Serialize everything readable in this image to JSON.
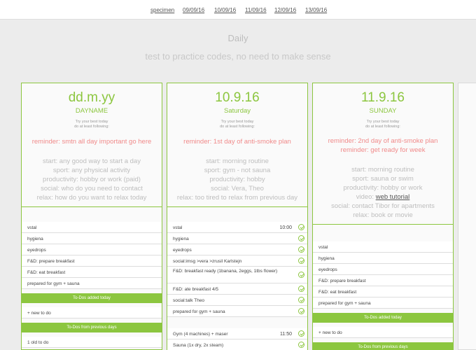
{
  "nav": [
    "specimen",
    "09/09/16",
    "10/09/16",
    "11/09/16",
    "12/09/16",
    "13/09/16"
  ],
  "title": "Daily",
  "subtitle": "test to practice codes, no need to make sense",
  "hint": [
    "Try your best today",
    "do at least following:"
  ],
  "cards": [
    {
      "date": "dd.m.yy",
      "dayname": "DAYNAME",
      "reminders": [
        "reminder: smtn all day important go here"
      ],
      "plan": [
        "start: any good way to start a day",
        "sport: any physical activity",
        "productivity: hobby or work (paid)",
        "social: who do you need to contact",
        "relax: how do you want to relax today"
      ],
      "tasks": [
        "vstal",
        "hygiena",
        "eyedrops",
        "F&D: prepare breakfast",
        "F&D: eat breakfast",
        "prepared for gym + sauna"
      ],
      "added_label": "To-Dos added today",
      "new_todo": "+ new to do",
      "prev_label": "To-Dos from previous days",
      "prev_tasks": [
        "1 old to do"
      ]
    },
    {
      "date": "10.9.16",
      "dayname": "Saturday",
      "reminders": [
        "reminder: 1st day of anti-smoke plan"
      ],
      "plan": [
        "start: morning routine",
        "sport: gym - not sauna",
        "productivity: hobby",
        "social: Vera, Theo",
        "relax: too tired to relax from previous day"
      ],
      "tasks": [
        {
          "text": "vstal",
          "time": "10:00"
        },
        {
          "text": "hygiena"
        },
        {
          "text": "eyedrops"
        },
        {
          "text": "social:imsg >vera >zrusil Karlstejn"
        },
        {
          "text": "F&D: breakfast ready (1banana, 2eggs, 1tbs flower)",
          "tall": true
        },
        {
          "text": "F&D: ate breakfast 4/5"
        },
        {
          "text": "social:talk Theo"
        },
        {
          "text": "prepared for gym + sauna"
        }
      ],
      "tasks2": [
        {
          "text": "Gym (4 machines) + maser",
          "time": "11:50"
        },
        {
          "text": "Sauna (1x dry, 2x steam)"
        }
      ]
    },
    {
      "date": "11.9.16",
      "dayname": "SUNDAY",
      "reminders": [
        "reminder: 2nd day of anti-smoke plan",
        "reminder: get ready for week"
      ],
      "plan": [
        "start: morning routine",
        "sport: sauna or swim",
        "productivity: hobby or work"
      ],
      "video_prefix": "video: ",
      "video_link": "web tutorial",
      "plan2": [
        "social: contact Tibor for apartments",
        "relax: book or movie"
      ],
      "tasks": [
        "vstal",
        "hygiena",
        "eyedrops",
        "F&D: prepare breakfast",
        "F&D: eat breakfast",
        "prepared for gym + sauna"
      ],
      "added_label": "To-Dos added today",
      "new_todo": "+ new to do",
      "prev_label": "To-Dos from previous days"
    }
  ]
}
